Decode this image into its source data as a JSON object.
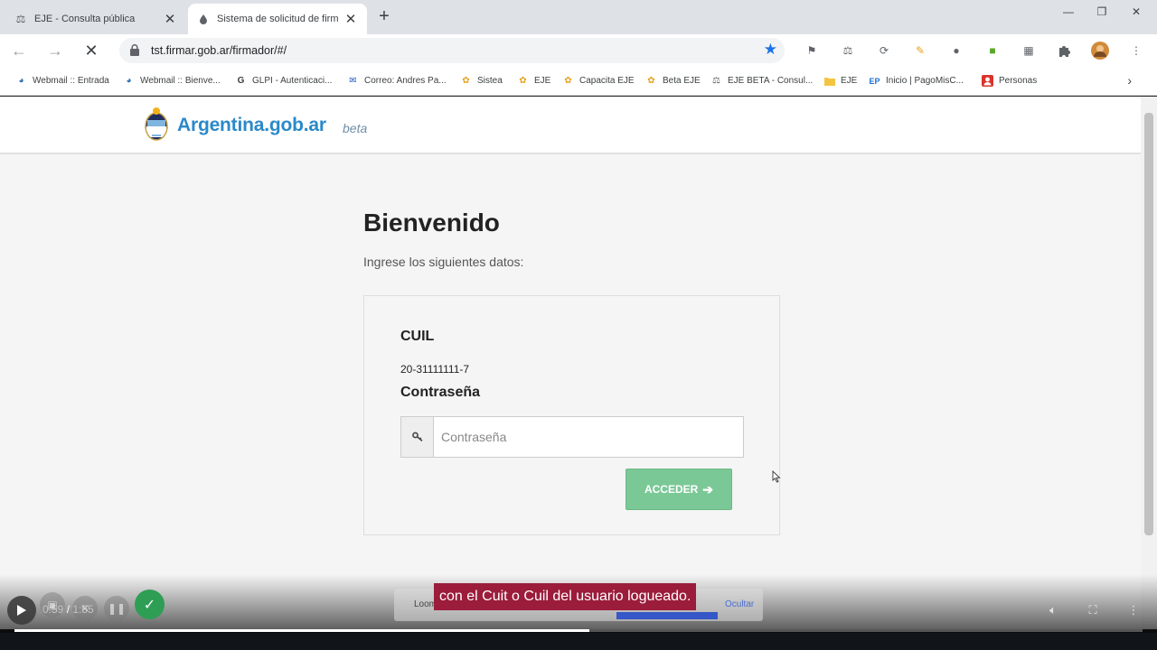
{
  "browser": {
    "tabs": [
      {
        "title": "EJE - Consulta pública",
        "active": false
      },
      {
        "title": "Sistema de solicitud de firma d",
        "active": true
      }
    ],
    "url": "tst.firmar.gob.ar/firmador/#/",
    "bookmarks": [
      {
        "label": "Webmail :: Entrada",
        "icon": "globe-icon"
      },
      {
        "label": "Webmail :: Bienve...",
        "icon": "globe-icon"
      },
      {
        "label": "GLPI - Autenticaci...",
        "icon": "g-icon"
      },
      {
        "label": "Correo: Andres Pa...",
        "icon": "mail-icon"
      },
      {
        "label": "Sistea",
        "icon": "flower-icon"
      },
      {
        "label": "EJE",
        "icon": "flower-icon"
      },
      {
        "label": "Capacita EJE",
        "icon": "flower-icon"
      },
      {
        "label": "Beta EJE",
        "icon": "flower-icon"
      },
      {
        "label": "EJE BETA - Consul...",
        "icon": "scale-icon"
      },
      {
        "label": "EJE",
        "icon": "folder-icon"
      },
      {
        "label": "Inicio | PagoMisC...",
        "icon": "ep-icon"
      },
      {
        "label": "Personas",
        "icon": "personas-icon"
      }
    ]
  },
  "site": {
    "logo_text": "Argentina.gob.ar",
    "logo_badge": "beta"
  },
  "login": {
    "title": "Bienvenido",
    "subtitle": "Ingrese los siguientes datos:",
    "cuil_label": "CUIL",
    "cuil_value": "20-31111111-7",
    "password_label": "Contraseña",
    "password_placeholder": "Contraseña",
    "submit_label": "ACCEDER"
  },
  "player": {
    "caption": "con el Cuit o Cuil del usuario logueado.",
    "time": "0:59 / 1:55",
    "progress_fraction": 0.51,
    "loom_word": "Loom",
    "loom_hide": "Ocultar"
  },
  "colors": {
    "brand_blue": "#2b89c9",
    "submit_green": "#7bc897",
    "caption_bg": "#9b1c3b",
    "star_blue": "#1a73e8"
  }
}
